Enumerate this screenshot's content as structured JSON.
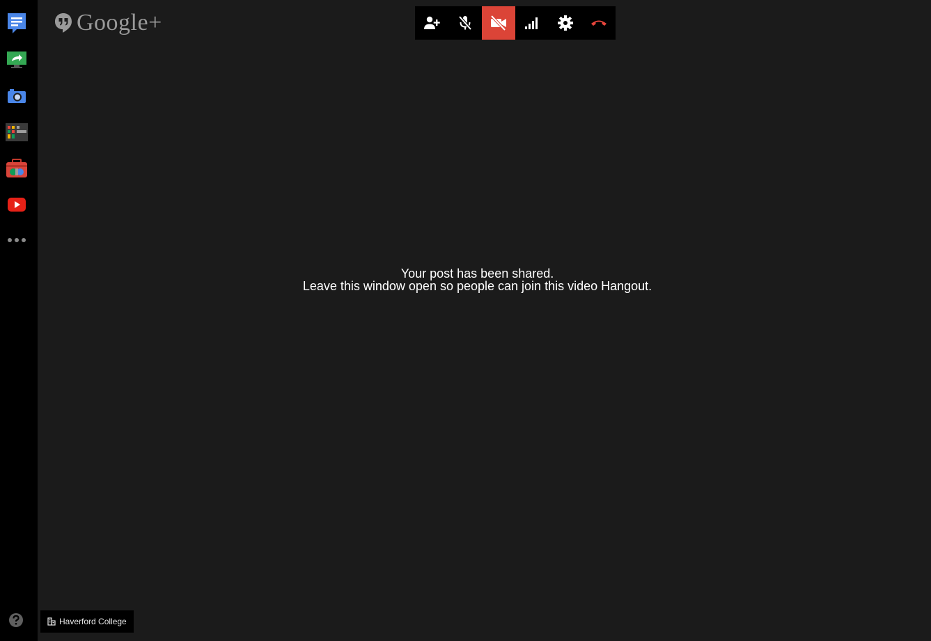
{
  "brand": {
    "text": "Google+"
  },
  "toolbar": {
    "items": [
      {
        "name": "invite-people",
        "icon": "add-person-icon"
      },
      {
        "name": "mute-microphone",
        "icon": "mic-off-icon"
      },
      {
        "name": "turn-off-camera",
        "icon": "camera-off-icon",
        "active": true
      },
      {
        "name": "bandwidth",
        "icon": "signal-bars-icon"
      },
      {
        "name": "settings",
        "icon": "gear-icon"
      },
      {
        "name": "leave-call",
        "icon": "phone-hangup-icon"
      }
    ],
    "active_color": "#db4437"
  },
  "rail": {
    "items": [
      {
        "name": "chat",
        "icon": "chat-icon"
      },
      {
        "name": "screenshare",
        "icon": "screenshare-icon"
      },
      {
        "name": "capture",
        "icon": "camera-icon"
      },
      {
        "name": "control-room",
        "icon": "control-room-icon"
      },
      {
        "name": "toolbox",
        "icon": "toolbox-icon"
      },
      {
        "name": "youtube",
        "icon": "youtube-icon"
      },
      {
        "name": "more-apps",
        "icon": "more-dots-icon"
      }
    ]
  },
  "message": {
    "line1": "Your post has been shared.",
    "line2": "Leave this window open so people can join this video Hangout."
  },
  "help": {
    "icon": "help-icon"
  },
  "location": {
    "icon": "building-icon",
    "label": "Haverford College"
  },
  "colors": {
    "background": "#1b1b1b",
    "rail": "#000000",
    "accent_red": "#db4437"
  }
}
